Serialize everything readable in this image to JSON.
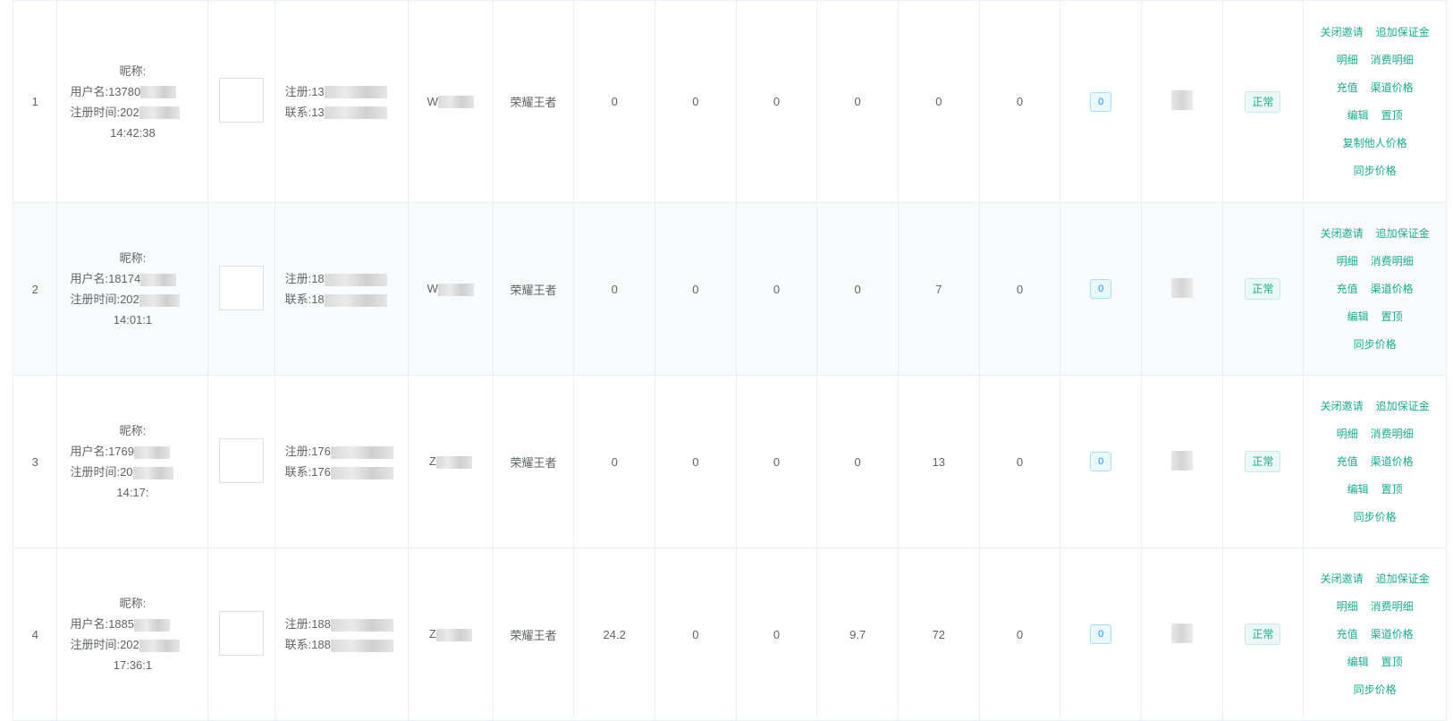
{
  "labels": {
    "nickname": "昵称:",
    "username": "用户名:",
    "reg_time": "注册时间:",
    "reg_phone": "注册:",
    "contact": "联系:"
  },
  "rows": [
    {
      "index": "1",
      "username_partial": "13780",
      "reg_date_partial": "202",
      "reg_clock_partial": "14:42:38",
      "reg_phone_partial": "13",
      "contact_partial": "13",
      "name_initial": "W",
      "rank": "荣耀王者",
      "stats": [
        "0",
        "0",
        "0",
        "0",
        "0",
        "0"
      ],
      "badge": "0",
      "status": "正常",
      "actions": [
        [
          "关闭邀请",
          "追加保证金"
        ],
        [
          "明细",
          "消费明细"
        ],
        [
          "充值",
          "渠道价格"
        ],
        [
          "编辑",
          "置顶"
        ],
        [
          "复制他人价格"
        ],
        [
          "同步价格"
        ]
      ]
    },
    {
      "index": "2",
      "username_partial": "18174",
      "reg_date_partial": "202",
      "reg_clock_partial": "14:01:1",
      "reg_phone_partial": "18",
      "contact_partial": "18",
      "name_initial": "W",
      "rank": "荣耀王者",
      "stats": [
        "0",
        "0",
        "0",
        "0",
        "7",
        "0"
      ],
      "badge": "0",
      "status": "正常",
      "actions": [
        [
          "关闭邀请",
          "追加保证金"
        ],
        [
          "明细",
          "消费明细"
        ],
        [
          "充值",
          "渠道价格"
        ],
        [
          "编辑",
          "置顶"
        ],
        [
          "同步价格"
        ]
      ]
    },
    {
      "index": "3",
      "username_partial": "1769",
      "reg_date_partial": "20",
      "reg_clock_partial": "14:17:",
      "reg_phone_partial": "176",
      "contact_partial": "176",
      "name_initial": "Z",
      "rank": "荣耀王者",
      "stats": [
        "0",
        "0",
        "0",
        "0",
        "13",
        "0"
      ],
      "badge": "0",
      "status": "正常",
      "actions": [
        [
          "关闭邀请",
          "追加保证金"
        ],
        [
          "明细",
          "消费明细"
        ],
        [
          "充值",
          "渠道价格"
        ],
        [
          "编辑",
          "置顶"
        ],
        [
          "同步价格"
        ]
      ]
    },
    {
      "index": "4",
      "username_partial": "1885",
      "reg_date_partial": "202",
      "reg_clock_partial": "17:36:1",
      "reg_phone_partial": "188",
      "contact_partial": "188",
      "name_initial": "Z",
      "rank": "荣耀王者",
      "stats": [
        "24.2",
        "0",
        "0",
        "9.7",
        "72",
        "0"
      ],
      "badge": "0",
      "status": "正常",
      "actions": [
        [
          "关闭邀请",
          "追加保证金"
        ],
        [
          "明细",
          "消费明细"
        ],
        [
          "充值",
          "渠道价格"
        ],
        [
          "编辑",
          "置顶"
        ],
        [
          "同步价格"
        ]
      ]
    }
  ],
  "colors": {
    "accent": "#1aaa8f",
    "border": "#ebeef5",
    "row_alt": "#f9fafc"
  }
}
